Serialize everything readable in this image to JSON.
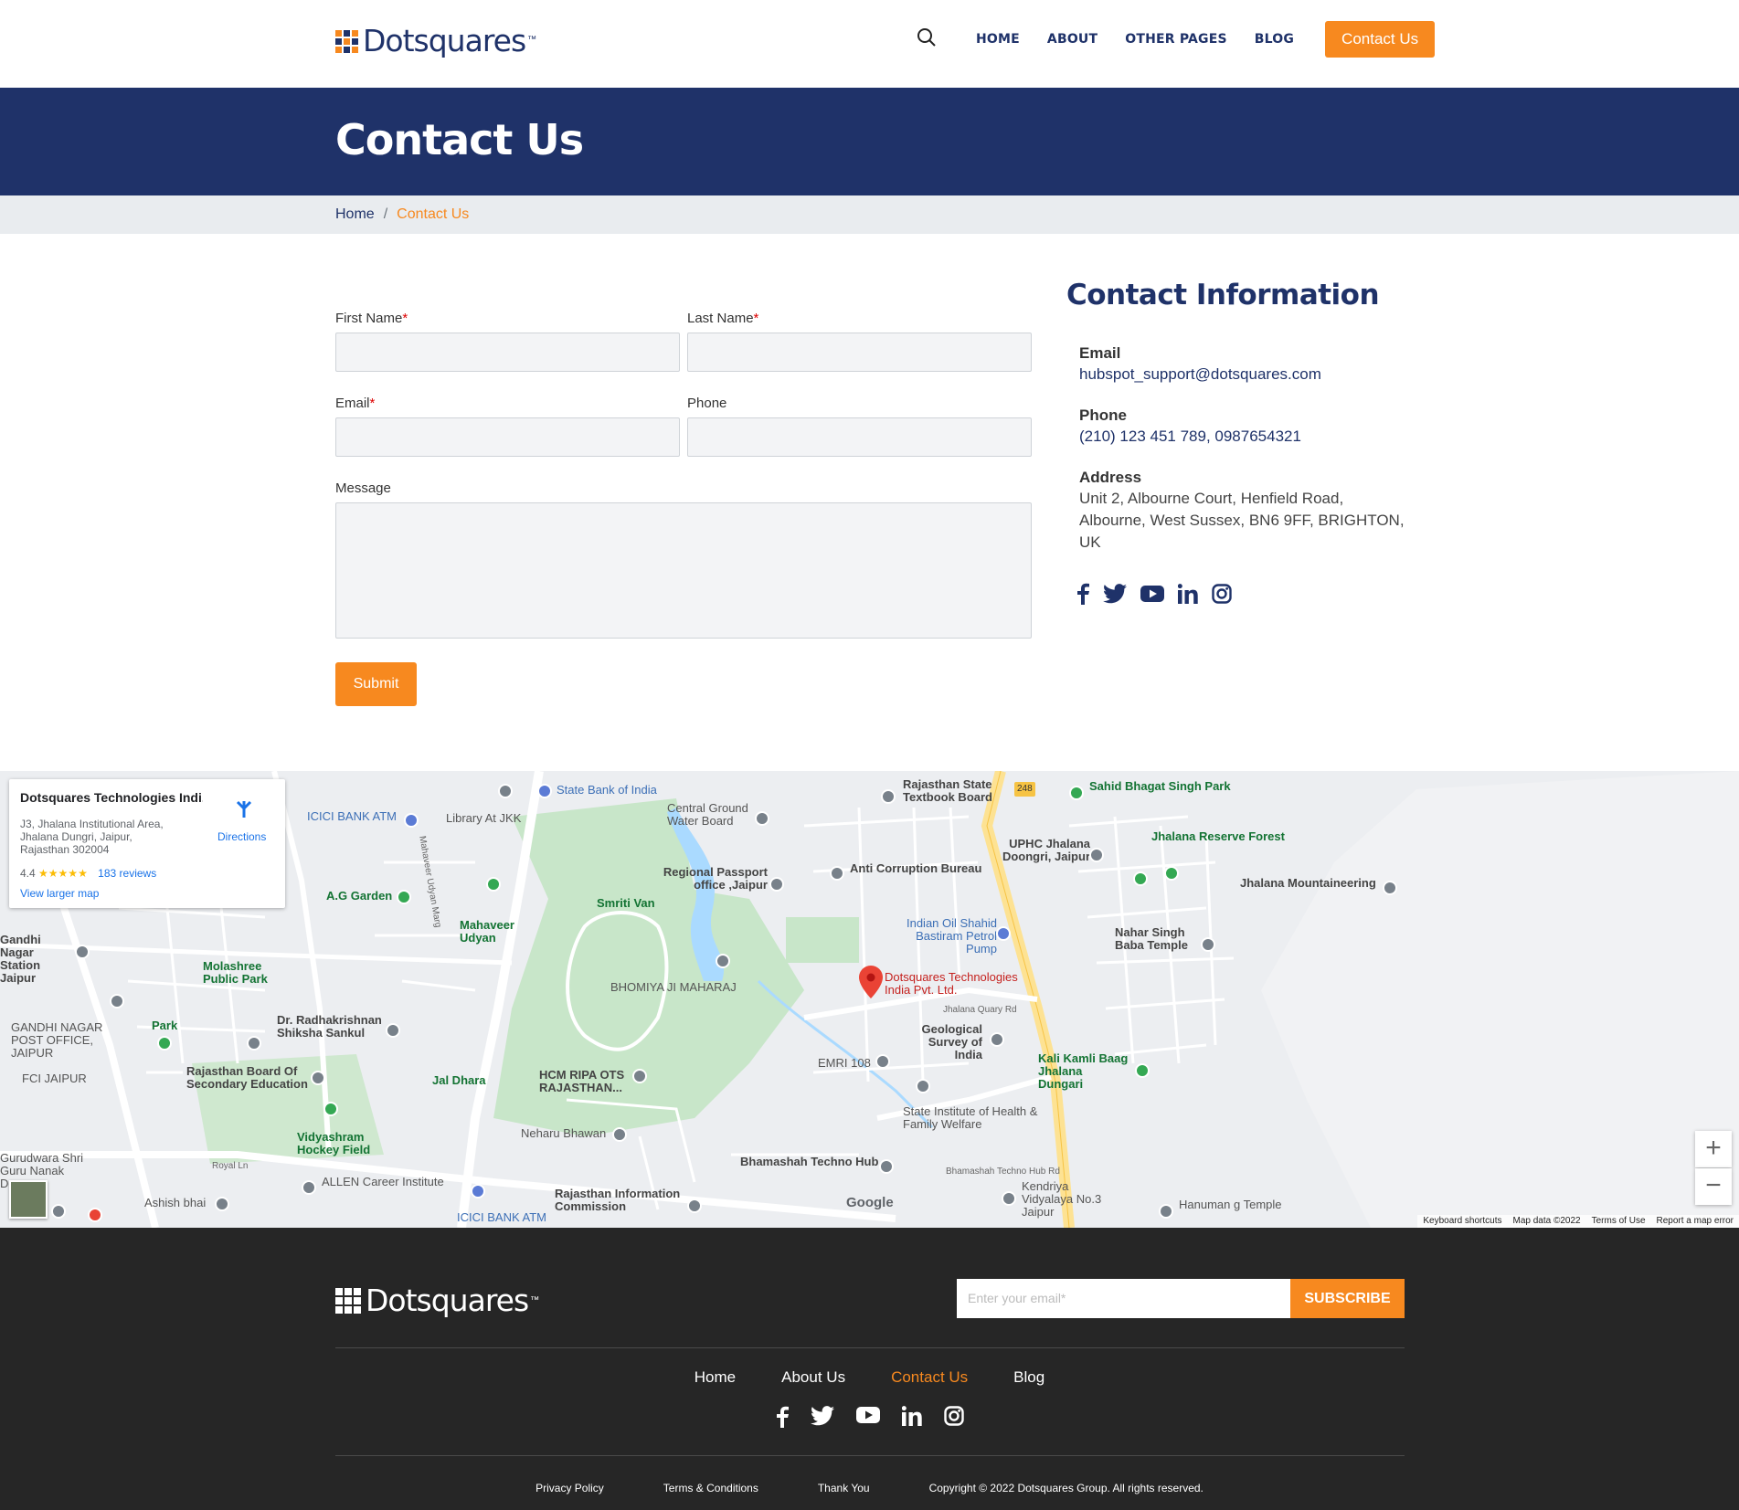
{
  "header": {
    "logo_text": "Dotsquares",
    "logo_tm": "™",
    "nav": [
      "HOME",
      "ABOUT",
      "OTHER PAGES",
      "BLOG"
    ],
    "cta": "Contact Us"
  },
  "banner": {
    "title": "Contact Us"
  },
  "breadcrumb": {
    "home": "Home",
    "sep": "/",
    "current": "Contact Us"
  },
  "form": {
    "first_name": "First Name",
    "last_name": "Last Name",
    "email": "Email",
    "phone": "Phone",
    "message": "Message",
    "required_mark": "*",
    "submit": "Submit"
  },
  "contact_info": {
    "title": "Contact Information",
    "email_label": "Email",
    "email": "hubspot_support@dotsquares.com",
    "phone_label": "Phone",
    "phone": "(210) 123 451 789, 0987654321",
    "address_label": "Address",
    "address": "Unit 2, Albourne Court, Henfield Road, Albourne, West Sussex, BN6 9FF, BRIGHTON, UK",
    "social": [
      "facebook-icon",
      "twitter-icon",
      "youtube-icon",
      "linkedin-icon",
      "instagram-icon"
    ]
  },
  "map": {
    "card": {
      "title": "Dotsquares Technologies Indi...",
      "address": "J3, Jhalana Institutional Area, Jhalana Dungri, Jaipur, Rajasthan 302004",
      "rating": "4.4",
      "stars": "★★★★★",
      "reviews": "183 reviews",
      "view_larger": "View larger map",
      "directions": "Directions"
    },
    "marker": "Dotsquares Technologies India Pvt. Ltd.",
    "labels": {
      "l1": "Rajasthan State Textbook Board",
      "l2": "Sahid Bhagat Singh Park",
      "l3": "Jhalana Reserve Forest",
      "l4": "Jhalana Mountaineering",
      "l5": "State Bank of India",
      "l6": "Central Ground Water Board",
      "l7": "UPHC Jhalana Doongri, Jaipur",
      "l8": "ICICI BANK ATM",
      "l9": "Library At JKK",
      "l10": "Anti Corruption Bureau",
      "l11": "Regional Passport office ,Jaipur",
      "l12": "Smriti Van",
      "l13": "A.G Garden",
      "l14": "Mahaveer Udyan",
      "l15": "Nahar Singh Baba Temple",
      "l16": "Indian Oil Shahid Bastiram Petrol Pump",
      "l17": "Gandhi Nagar Station Jaipur",
      "l18": "Molashree Public Park",
      "l19": "BHOMIYA JI MAHARAJ",
      "l20": "GANDHI NAGAR POST OFFICE, JAIPUR",
      "l21": "Dr. Radhakrishnan Shiksha Sankul",
      "l22": "Geological Survey of India",
      "l23": "Park",
      "l24": "EMRI 108",
      "l25": "Kali Kamli Baag Jhalana Dungari",
      "l26": "FCI JAIPUR",
      "l27": "Rajasthan Board Of Secondary Education",
      "l28": "Jal Dhara",
      "l29": "HCM RIPA OTS RAJASTHAN...",
      "l30": "State Institute of Health & Family Welfare",
      "l31": "Vidyashram Hockey Field",
      "l32": "Neharu Bhawan",
      "l33": "Gurudwara Shri Guru Nanak Dev...",
      "l34": "ALLEN Career Institute",
      "l35": "Bhamashah Techno Hub",
      "l36": "Kendriya Vidyalaya No.3 Jaipur",
      "l37": "Hanuman g Temple",
      "l38": "Ashish bhai",
      "l39": "Rajasthan Information Commission",
      "l40": "ICICI BANK ATM",
      "l41": "Jhalana Quary Rd",
      "l42": "Bhamashah Techno Hub Rd",
      "l43": "Royal Ln",
      "l44": "Mahaveer Udyan Marg",
      "l45": "248",
      "l46": "Google"
    },
    "footer": [
      "Keyboard shortcuts",
      "Map data ©2022",
      "Terms of Use",
      "Report a map error"
    ]
  },
  "footer": {
    "logo_text": "Dotsquares",
    "logo_tm": "™",
    "subscribe_placeholder": "Enter your email*",
    "subscribe_btn": "SUBSCRIBE",
    "links": [
      "Home",
      "About Us",
      "Contact Us",
      "Blog"
    ],
    "bottom": [
      "Privacy Policy",
      "Terms & Conditions",
      "Thank You",
      "Copyright © 2022 Dotsquares Group. All rights reserved."
    ]
  },
  "colors": {
    "navy": "#1f3269",
    "orange": "#f7891f",
    "footer_bg": "#262626"
  }
}
